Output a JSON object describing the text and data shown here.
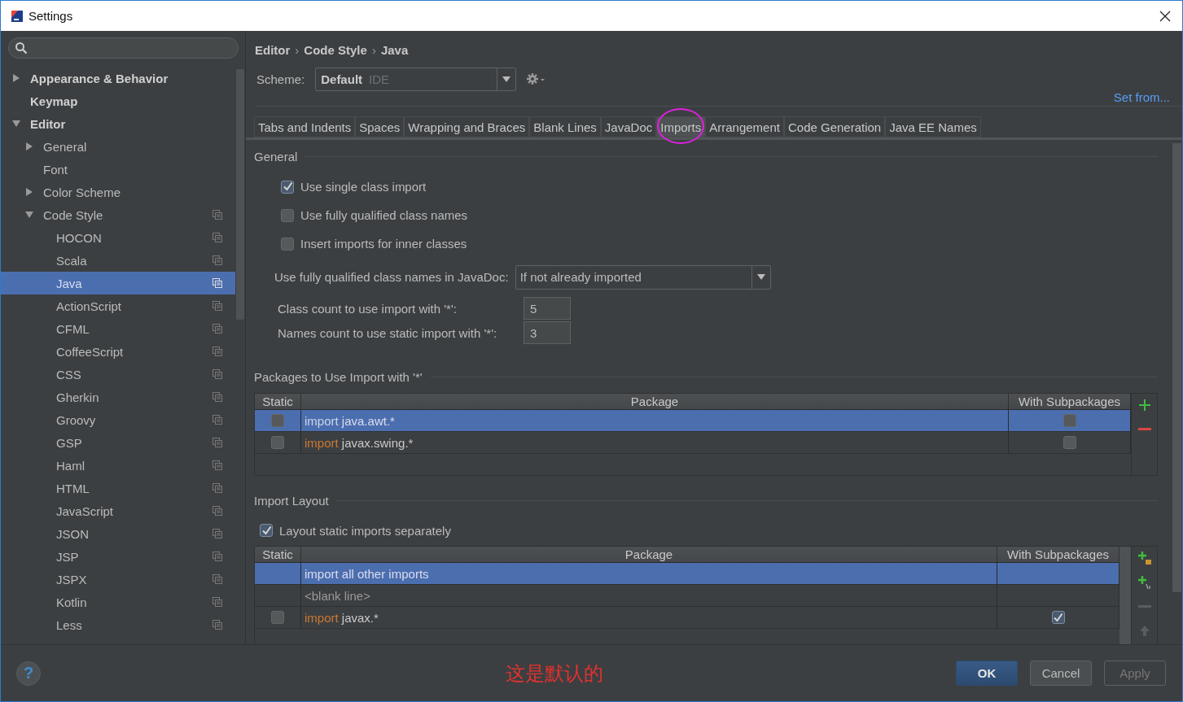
{
  "window": {
    "title": "Settings"
  },
  "sidebar": {
    "items": [
      {
        "label": "Appearance & Behavior",
        "kind": "page",
        "expanded": false,
        "selected": false
      },
      {
        "label": "Keymap",
        "kind": "page",
        "selected": false
      },
      {
        "label": "Editor",
        "kind": "page",
        "expanded": true,
        "selected": false,
        "children": [
          {
            "label": "General",
            "kind": "page",
            "expanded": false,
            "selected": false
          },
          {
            "label": "Font",
            "kind": "page",
            "selected": false
          },
          {
            "label": "Color Scheme",
            "kind": "page",
            "expanded": false,
            "selected": false
          },
          {
            "label": "Code Style",
            "kind": "scheme",
            "expanded": true,
            "selected": false,
            "children": [
              {
                "label": "HOCON",
                "kind": "scheme",
                "selected": false
              },
              {
                "label": "Scala",
                "kind": "scheme",
                "selected": false
              },
              {
                "label": "Java",
                "kind": "scheme",
                "selected": true
              },
              {
                "label": "ActionScript",
                "kind": "scheme",
                "selected": false
              },
              {
                "label": "CFML",
                "kind": "scheme",
                "selected": false
              },
              {
                "label": "CoffeeScript",
                "kind": "scheme",
                "selected": false
              },
              {
                "label": "CSS",
                "kind": "scheme",
                "selected": false
              },
              {
                "label": "Gherkin",
                "kind": "scheme",
                "selected": false
              },
              {
                "label": "Groovy",
                "kind": "scheme",
                "selected": false
              },
              {
                "label": "GSP",
                "kind": "scheme",
                "selected": false
              },
              {
                "label": "Haml",
                "kind": "scheme",
                "selected": false
              },
              {
                "label": "HTML",
                "kind": "scheme",
                "selected": false
              },
              {
                "label": "JavaScript",
                "kind": "scheme",
                "selected": false
              },
              {
                "label": "JSON",
                "kind": "scheme",
                "selected": false
              },
              {
                "label": "JSP",
                "kind": "scheme",
                "selected": false
              },
              {
                "label": "JSPX",
                "kind": "scheme",
                "selected": false
              },
              {
                "label": "Kotlin",
                "kind": "scheme",
                "selected": false
              },
              {
                "label": "Less",
                "kind": "scheme",
                "selected": false
              }
            ]
          }
        ]
      }
    ]
  },
  "breadcrumb": {
    "separator": "›",
    "parts": [
      "Editor",
      "Code Style",
      "Java"
    ]
  },
  "scheme": {
    "label": "Scheme:",
    "value": "Default",
    "tag": "IDE"
  },
  "set_from_link": "Set from...",
  "tabs": [
    {
      "label": "Tabs and Indents",
      "selected": false,
      "circled": false
    },
    {
      "label": "Spaces",
      "selected": false,
      "circled": false
    },
    {
      "label": "Wrapping and Braces",
      "selected": false,
      "circled": false
    },
    {
      "label": "Blank Lines",
      "selected": false,
      "circled": false
    },
    {
      "label": "JavaDoc",
      "selected": false,
      "circled": false
    },
    {
      "label": "Imports",
      "selected": true,
      "circled": true
    },
    {
      "label": "Arrangement",
      "selected": false,
      "circled": false
    },
    {
      "label": "Code Generation",
      "selected": false,
      "circled": false
    },
    {
      "label": "Java EE Names",
      "selected": false,
      "circled": false
    }
  ],
  "general": {
    "heading": "General",
    "options": [
      {
        "label": "Use single class import",
        "checked": true
      },
      {
        "label": "Use fully qualified class names",
        "checked": false
      },
      {
        "label": "Insert imports for inner classes",
        "checked": false
      }
    ],
    "javadoc": {
      "label": "Use fully qualified class names in JavaDoc:",
      "value": "If not already imported"
    },
    "counts": [
      {
        "label": "Class count to use import with '*':",
        "value": "5"
      },
      {
        "label": "Names count to use static import with '*':",
        "value": "3"
      }
    ]
  },
  "packages": {
    "heading": "Packages to Use Import with '*'",
    "columns": [
      "Static",
      "Package",
      "With Subpackages"
    ],
    "rows": [
      {
        "static": false,
        "keyword": "import",
        "package": "java.awt.*",
        "with_subpackages": false,
        "selected": true
      },
      {
        "static": false,
        "keyword": "import",
        "package": "javax.swing.*",
        "with_subpackages": false,
        "selected": false
      }
    ]
  },
  "import_layout": {
    "heading": "Import Layout",
    "separate_static": {
      "label": "Layout static imports separately",
      "checked": true
    },
    "columns": [
      "Static",
      "Package",
      "With Subpackages"
    ],
    "rows": [
      {
        "kind": "all_other",
        "text": "import all other imports",
        "selected": true
      },
      {
        "kind": "blank",
        "text": "<blank line>",
        "selected": false
      },
      {
        "kind": "package",
        "static": false,
        "keyword": "import",
        "package": "javax.*",
        "with_subpackages": true,
        "selected": false
      }
    ]
  },
  "footer": {
    "help": "?",
    "annotation": "这是默认的",
    "buttons": [
      {
        "label": "OK",
        "kind": "default"
      },
      {
        "label": "Cancel",
        "kind": "normal"
      },
      {
        "label": "Apply",
        "kind": "disabled"
      }
    ]
  }
}
